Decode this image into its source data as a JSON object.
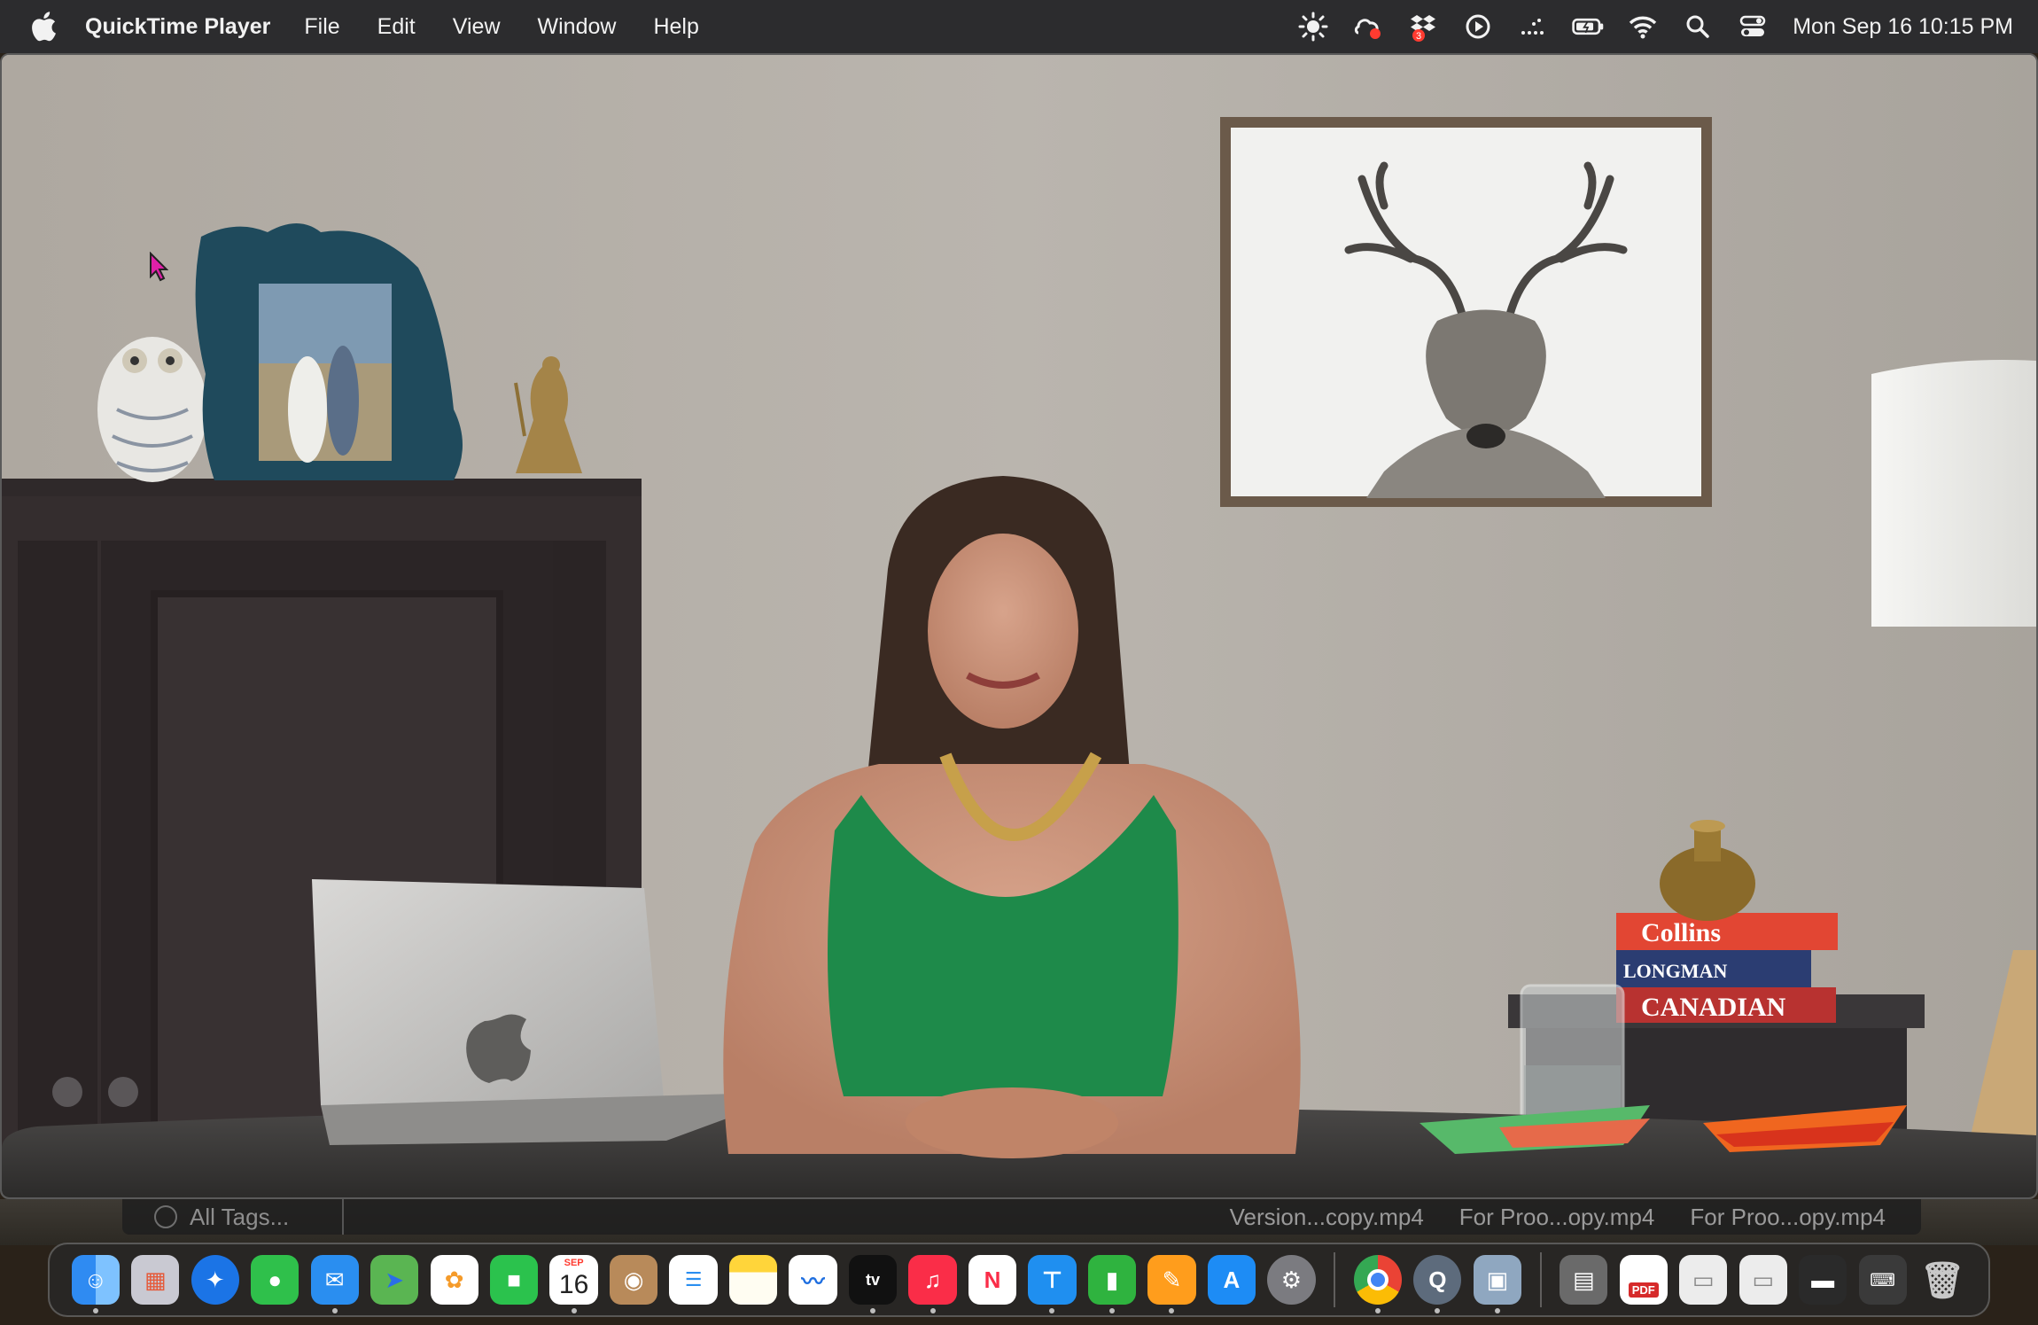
{
  "menubar": {
    "app_name": "QuickTime Player",
    "menus": [
      "File",
      "Edit",
      "View",
      "Window",
      "Help"
    ],
    "status_icons": [
      "brightness-icon",
      "creative-cloud-icon",
      "dropbox-icon",
      "play-circle-icon",
      "dots-icon",
      "battery-icon",
      "wifi-icon",
      "search-icon",
      "control-center-icon"
    ],
    "dropbox_badge": "3",
    "clock": "Mon Sep 16  10:15 PM"
  },
  "video": {
    "book_spines": [
      "Collins",
      "LONGMAN",
      "CANADIAN"
    ]
  },
  "finder": {
    "tag_filter": "All Tags...",
    "files": [
      "Version...copy.mp4",
      "For Proo...opy.mp4",
      "For Proo...opy.mp4"
    ]
  },
  "dock": {
    "calendar_month": "SEP",
    "calendar_day": "16",
    "apps": [
      {
        "name": "Finder",
        "icon": "finder-icon",
        "color": "#2f8bf2"
      },
      {
        "name": "Launchpad",
        "icon": "launchpad-icon",
        "color": "#c9c9d2"
      },
      {
        "name": "Safari",
        "icon": "safari-icon",
        "color": "#1b74e6"
      },
      {
        "name": "Messages",
        "icon": "messages-icon",
        "color": "#2fc04b"
      },
      {
        "name": "Mail",
        "icon": "mail-icon",
        "color": "#2a8ef0"
      },
      {
        "name": "Maps",
        "icon": "maps-icon",
        "color": "#5ab552"
      },
      {
        "name": "Photos",
        "icon": "photos-icon",
        "color": "#ffffff"
      },
      {
        "name": "FaceTime",
        "icon": "facetime-icon",
        "color": "#2bc24d"
      },
      {
        "name": "Calendar",
        "icon": "calendar-icon",
        "color": "#ffffff"
      },
      {
        "name": "Contacts",
        "icon": "contacts-icon",
        "color": "#b88a5a"
      },
      {
        "name": "Reminders",
        "icon": "reminders-icon",
        "color": "#ffffff"
      },
      {
        "name": "Notes",
        "icon": "notes-icon",
        "color": "#ffd53a"
      },
      {
        "name": "Freeform",
        "icon": "freeform-icon",
        "color": "#ffffff"
      },
      {
        "name": "TV",
        "icon": "tv-icon",
        "color": "#111111"
      },
      {
        "name": "Music",
        "icon": "music-icon",
        "color": "#fa2d48"
      },
      {
        "name": "News",
        "icon": "news-icon",
        "color": "#ffffff"
      },
      {
        "name": "Keynote",
        "icon": "keynote-icon",
        "color": "#1f8ff0"
      },
      {
        "name": "Numbers",
        "icon": "numbers-icon",
        "color": "#2fb33f"
      },
      {
        "name": "Pages",
        "icon": "pages-icon",
        "color": "#ff9d1c"
      },
      {
        "name": "App Store",
        "icon": "app-store-icon",
        "color": "#1d8cf5"
      },
      {
        "name": "System Settings",
        "icon": "system-settings-icon",
        "color": "#7b7b80"
      }
    ],
    "running_apps": [
      {
        "name": "Chrome",
        "icon": "chrome-icon",
        "color": "#ffffff"
      },
      {
        "name": "QuickTime Player",
        "icon": "quicktime-icon",
        "color": "#5d6b7c"
      },
      {
        "name": "Preview",
        "icon": "preview-icon",
        "color": "#8fa7c0"
      }
    ],
    "documents": [
      {
        "name": "Desktop folder",
        "icon": "folder-stack-icon",
        "color": "#6a6a6a"
      },
      {
        "name": "PDF document",
        "icon": "pdf-icon",
        "color": "#ffffff",
        "label": "PDF"
      },
      {
        "name": "Chrome document 1",
        "icon": "document-icon",
        "color": "#ececec"
      },
      {
        "name": "Chrome document 2",
        "icon": "document-icon",
        "color": "#ececec"
      },
      {
        "name": "Dark document",
        "icon": "document-dark-icon",
        "color": "#2a2a2a"
      },
      {
        "name": "Keyboard document",
        "icon": "keyboard-document-icon",
        "color": "#3a3a3a"
      },
      {
        "name": "Trash",
        "icon": "trash-icon",
        "color": "#9a9a9a"
      }
    ]
  }
}
